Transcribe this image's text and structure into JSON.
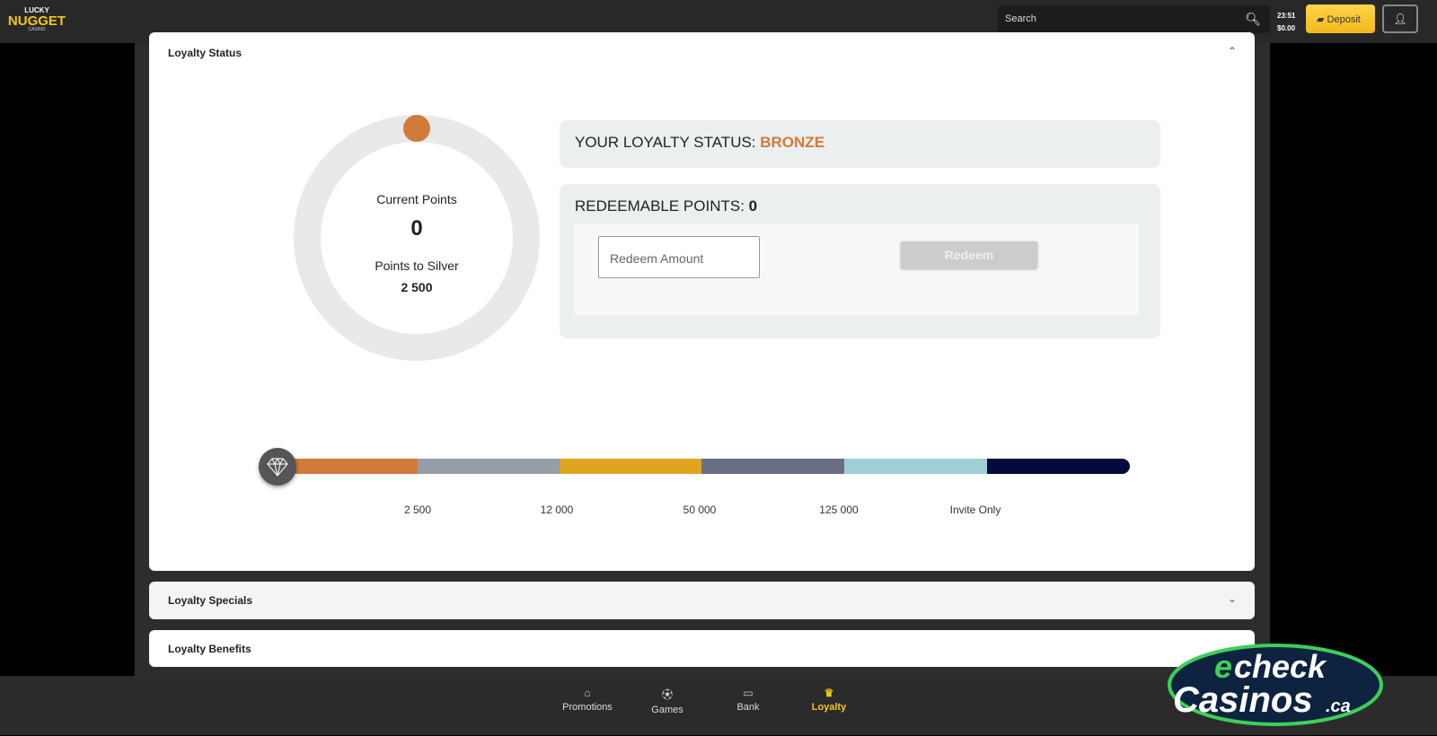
{
  "header": {
    "logo": [
      "LUCKY",
      "NUGGET",
      "CASINO"
    ],
    "search_placeholder": "Search",
    "time": "23:51",
    "balance": "$0.00",
    "deposit_label": "Deposit"
  },
  "loyalty_status": {
    "title": "Loyalty Status",
    "current_points_label": "Current Points",
    "current_points": "0",
    "points_to_next_label": "Points to Silver",
    "points_to_next": "2 500",
    "status_prefix": "YOUR LOYALTY STATUS: ",
    "status_value": "BRONZE",
    "redeemable_label": "REDEEMABLE POINTS: ",
    "redeemable_value": "0",
    "redeem_placeholder": "Redeem Amount",
    "redeem_button": "Redeem",
    "progress_fraction": 0,
    "tiers": [
      {
        "color": "#d27a38"
      },
      {
        "color": "#969da6"
      },
      {
        "color": "#dfa521"
      },
      {
        "color": "#6a6e85"
      },
      {
        "color": "#9fcfd4"
      },
      {
        "color": "#050a3a"
      }
    ],
    "tier_thresholds": [
      "2 500",
      "12 000",
      "50 000",
      "125 000",
      "Invite Only"
    ]
  },
  "sections": {
    "specials": "Loyalty Specials",
    "benefits": "Loyalty Benefits"
  },
  "bottom_nav": [
    {
      "label": "Promotions",
      "icon": "home-icon"
    },
    {
      "label": "Games",
      "icon": "ball-icon"
    },
    {
      "label": "Bank",
      "icon": "cards-icon"
    },
    {
      "label": "Loyalty",
      "icon": "crown-icon",
      "active": true
    }
  ],
  "colors": {
    "accent": "#f5c518",
    "bronze": "#d27a38"
  },
  "watermark": "echeckCasinos.ca"
}
